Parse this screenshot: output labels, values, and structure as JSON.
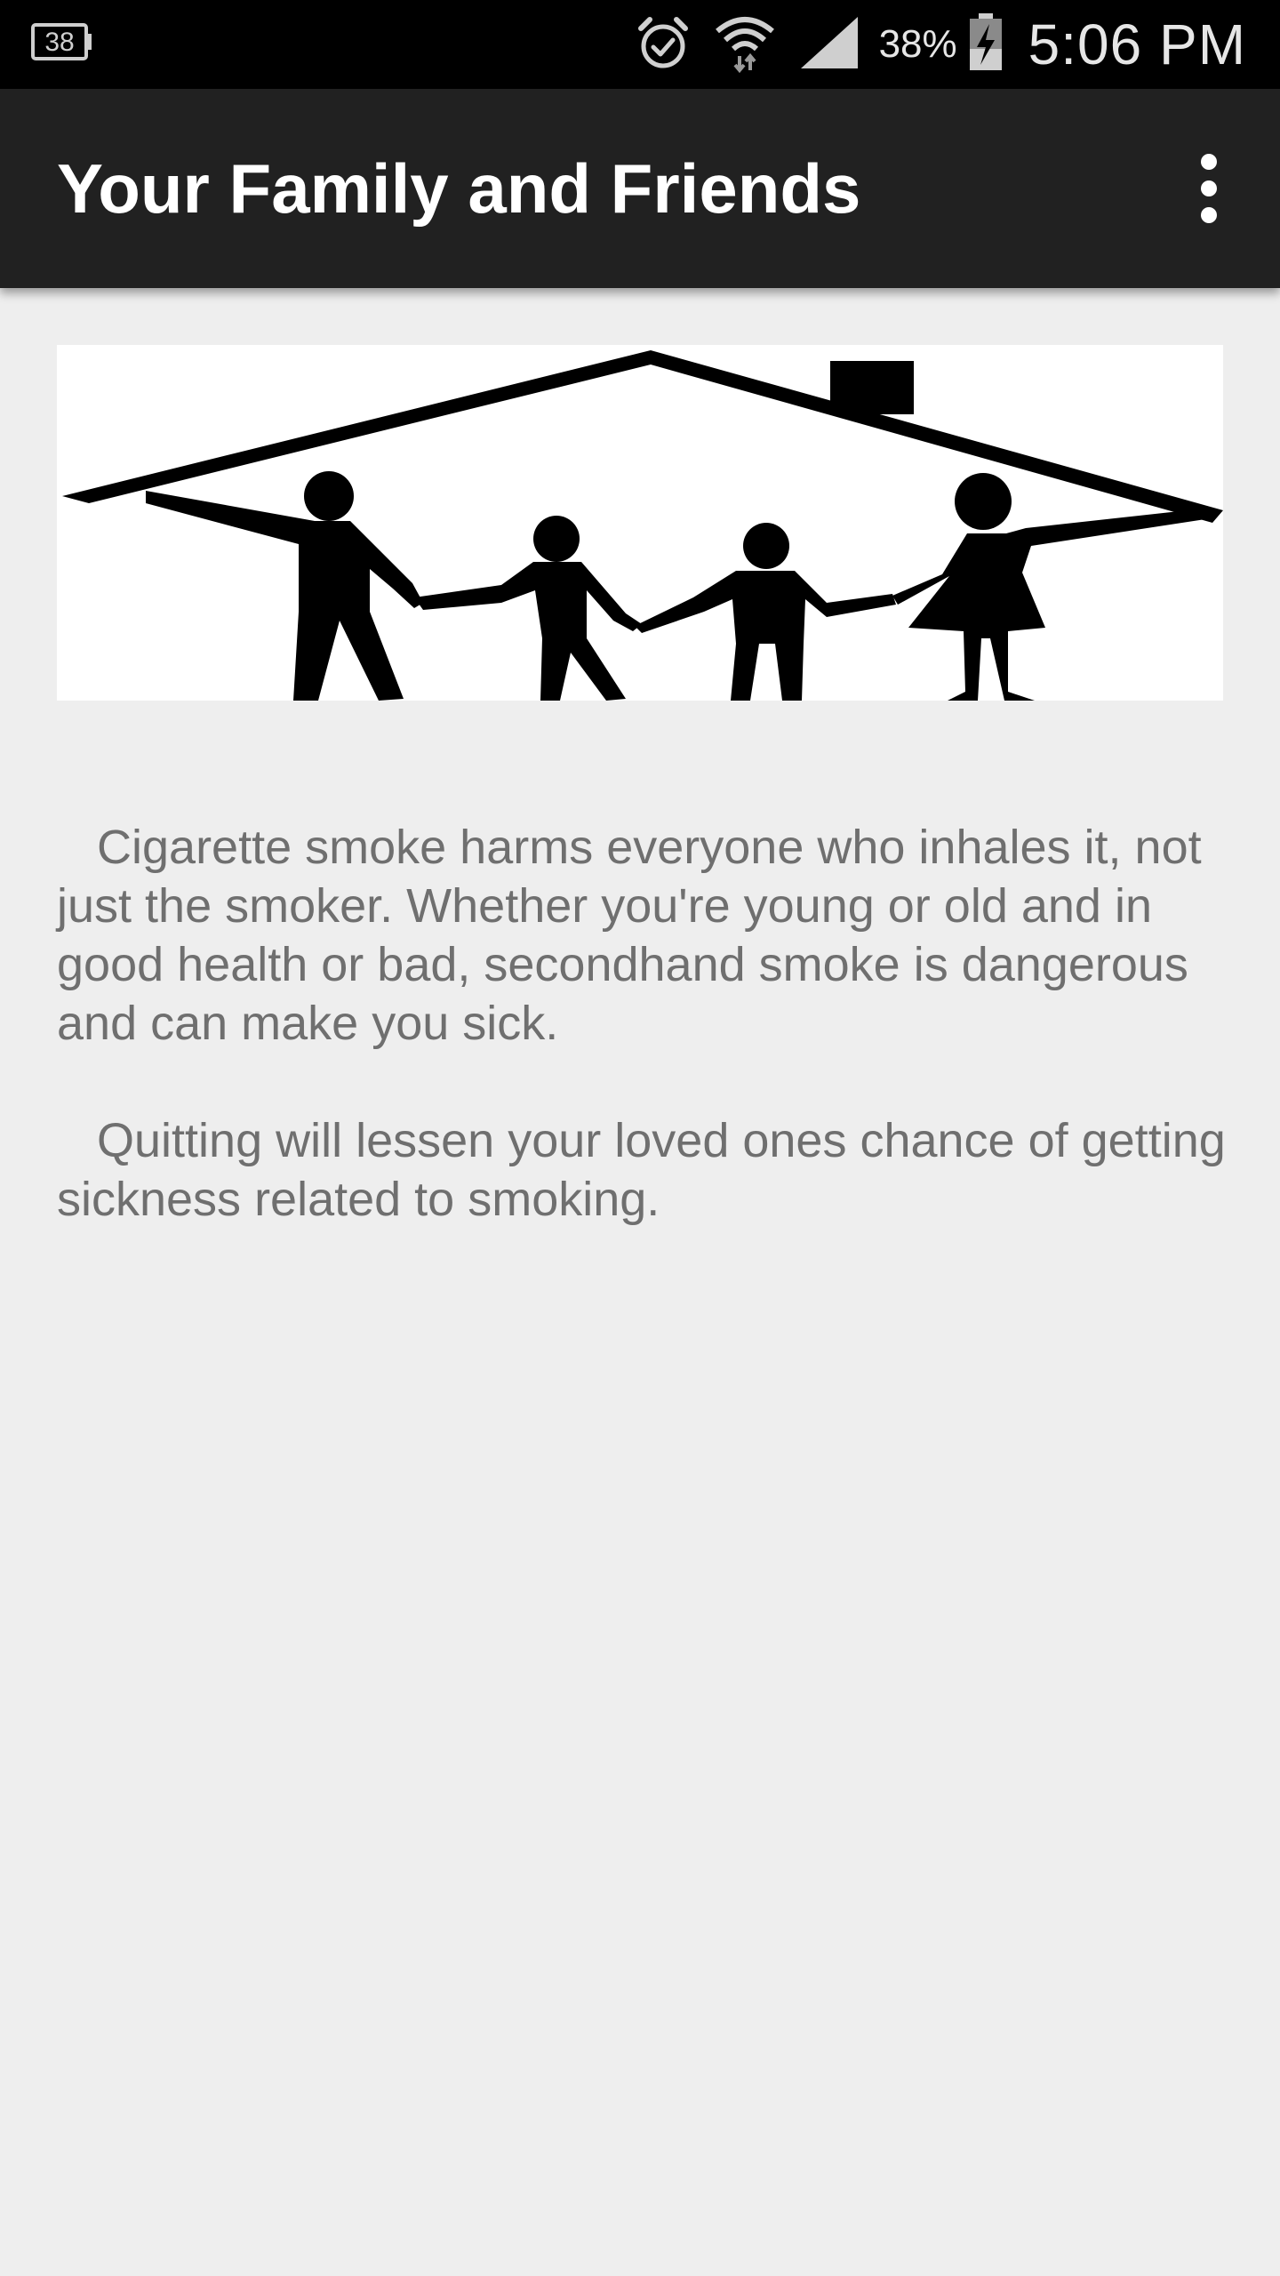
{
  "status_bar": {
    "notification_badge": "38",
    "battery_percent": "38%",
    "time": "5:06 PM",
    "icons": [
      "notification-badge-icon",
      "alarm-icon",
      "wifi-icon",
      "signal-icon",
      "battery-charging-icon"
    ],
    "background_color": "#000000"
  },
  "app_bar": {
    "title": "Your Family and Friends",
    "overflow_icon": "more-vertical-icon",
    "background_color": "#212121"
  },
  "hero_image": {
    "subject": "family-under-roof-silhouette"
  },
  "content": {
    "paragraphs": [
      "   Cigarette smoke harms everyone who inhales it, not just the smoker. Whether you're young or old and in good health or bad, secondhand smoke is dangerous and can make you sick.",
      "   Quitting will lessen your loved ones chance of getting sickness related to smoking."
    ],
    "text_color": "#6f6f6f",
    "page_background": "#eeeeee"
  }
}
